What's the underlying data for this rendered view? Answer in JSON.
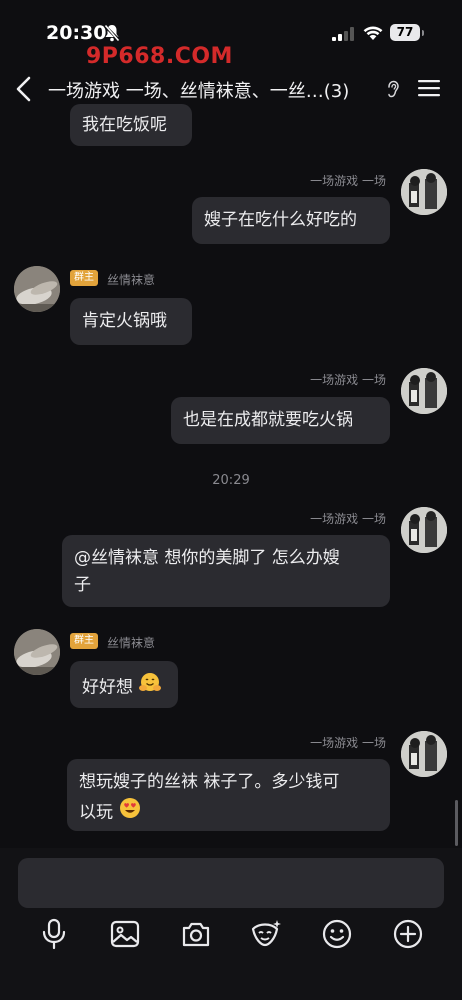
{
  "status_bar": {
    "time": "20:30",
    "battery": "77"
  },
  "watermark": "9P668.COM",
  "header": {
    "title": "一场游戏 一场、丝情袜意、一丝…(3)"
  },
  "messages": [
    {
      "sender": "",
      "text": "我在吃饭呢",
      "side": "left"
    },
    {
      "sender": "一场游戏 一场",
      "text": "嫂子在吃什么好吃的",
      "side": "right"
    },
    {
      "sender": "丝情袜意",
      "badge": "群主",
      "text": "肯定火锅哦",
      "side": "left"
    },
    {
      "sender": "一场游戏 一场",
      "text": "也是在成都就要吃火锅",
      "side": "right"
    },
    {
      "sender": "一场游戏 一场",
      "text_line1": "@丝情袜意 想你的美脚了 怎么办嫂",
      "text_line2": "子",
      "side": "right"
    },
    {
      "sender": "丝情袜意",
      "badge": "群主",
      "text": "好好想",
      "emoji": "hugging-face",
      "side": "left"
    },
    {
      "sender": "一场游戏 一场",
      "text_line1": "想玩嫂子的丝袜 袜子了。多少钱可",
      "text_line2": "以玩",
      "emoji": "heart-eyes",
      "side": "right"
    }
  ],
  "timestamp": "20:29",
  "toolbar": [
    "microphone-icon",
    "image-icon",
    "camera-icon",
    "sticker-icon",
    "emoji-icon",
    "plus-icon"
  ]
}
